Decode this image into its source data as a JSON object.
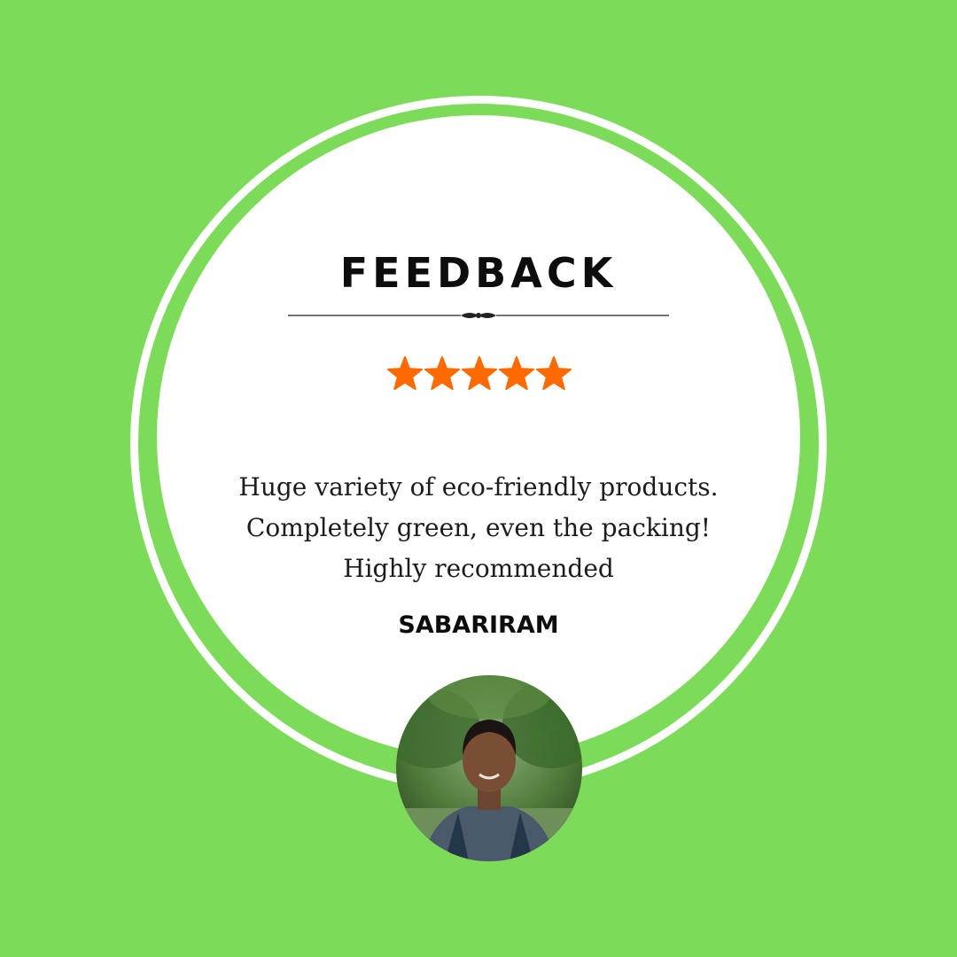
{
  "card": {
    "title": "FEEDBACK",
    "rating": 5,
    "quote": "Huge variety of eco-friendly products. Completely green, even the packing! Highly recommended",
    "author": "SABARIRAM"
  },
  "colors": {
    "background": "#7ddb5a",
    "circle": "#ffffff",
    "star": "#ff6a00",
    "text": "#0d0d0d"
  },
  "icons": {
    "divider": "ornamental-divider-icon",
    "star": "star-icon",
    "avatar": "avatar-photo"
  }
}
